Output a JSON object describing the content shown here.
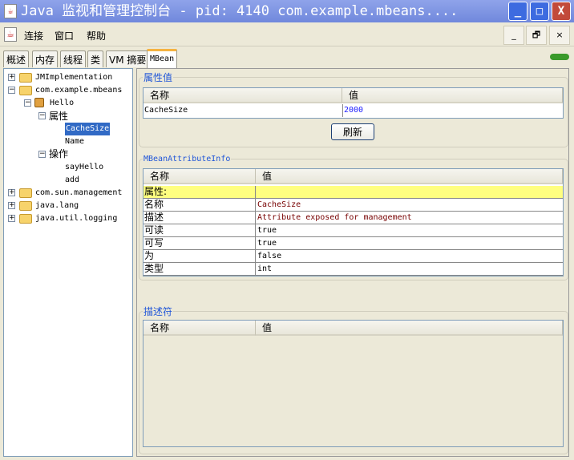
{
  "window": {
    "title": "Java 监视和管理控制台 - pid: 4140 com.example.mbeans....",
    "minimize": "_",
    "maximize": "□",
    "close": "X"
  },
  "menu": {
    "items": [
      "连接",
      "窗口",
      "帮助"
    ],
    "inner_buttons": [
      "_",
      "🗗",
      "×"
    ]
  },
  "tabs": [
    "概述",
    "内存",
    "线程",
    "类",
    "VM 摘要",
    "MBean"
  ],
  "tree": {
    "nodes": [
      {
        "label": "JMImplementation",
        "exp": "+"
      },
      {
        "label": "com.example.mbeans",
        "exp": "−"
      },
      {
        "label": "Hello",
        "exp": "−"
      },
      {
        "label": "属性",
        "exp": "−"
      },
      {
        "label": "CacheSize"
      },
      {
        "label": "Name"
      },
      {
        "label": "操作",
        "exp": "−"
      },
      {
        "label": "sayHello"
      },
      {
        "label": "add"
      },
      {
        "label": "com.sun.management",
        "exp": "+"
      },
      {
        "label": "java.lang",
        "exp": "+"
      },
      {
        "label": "java.util.logging",
        "exp": "+"
      }
    ]
  },
  "attr_values": {
    "title": "属性值",
    "col_name": "名称",
    "col_value": "值",
    "row": {
      "name": "CacheSize",
      "value": "2000"
    },
    "refresh": "刷新"
  },
  "attr_info": {
    "title": "MBeanAttributeInfo",
    "col_name": "名称",
    "col_value": "值",
    "rows": [
      {
        "name": "属性:",
        "value": ""
      },
      {
        "name": "名称",
        "value": "CacheSize"
      },
      {
        "name": "描述",
        "value": "Attribute exposed for management"
      },
      {
        "name": "可读",
        "value": "true"
      },
      {
        "name": "可写",
        "value": "true"
      },
      {
        "name": "为",
        "value": "false"
      },
      {
        "name": "类型",
        "value": "int"
      }
    ]
  },
  "descriptor": {
    "title": "描述符",
    "col_name": "名称",
    "col_value": "值"
  },
  "colors": {
    "highlight": "#ffff80",
    "selection": "#316ac5",
    "legend": "#1f55d8"
  }
}
